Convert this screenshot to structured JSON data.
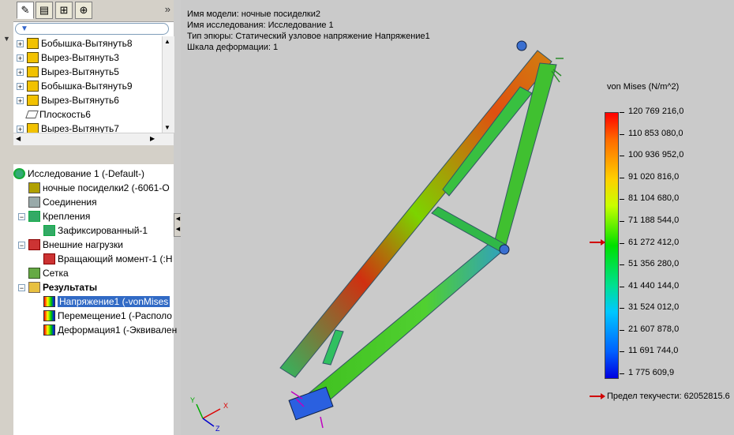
{
  "toolbar": {
    "more_label": "»"
  },
  "filter": {
    "value": "",
    "icon": "filter-icon"
  },
  "feature_tree": [
    {
      "label": "Бобышка-Вытянуть8",
      "icon": "boss-extrude-icon"
    },
    {
      "label": "Вырез-Вытянуть3",
      "icon": "cut-extrude-icon"
    },
    {
      "label": "Вырез-Вытянуть5",
      "icon": "cut-extrude-icon"
    },
    {
      "label": "Бобышка-Вытянуть9",
      "icon": "boss-extrude-icon"
    },
    {
      "label": "Вырез-Вытянуть6",
      "icon": "cut-extrude-icon"
    },
    {
      "label": "Плоскость6",
      "icon": "plane-icon"
    },
    {
      "label": "Вырез-Вытянуть7",
      "icon": "cut-extrude-icon"
    }
  ],
  "sim_tree": {
    "study": "Исследование 1 (-Default-)",
    "part": "ночные посиделки2 (-6061-O",
    "connections": "Соединения",
    "fixtures": "Крепления",
    "fixed": "Зафиксированный-1",
    "external_loads": "Внешние нагрузки",
    "torque": "Вращающий момент-1 (:Н",
    "mesh": "Сетка",
    "results": "Результаты",
    "stress": "Напряжение1 (-vonMises",
    "displacement": "Перемещение1 (-Располо",
    "strain": "Деформация1 (-Эквивален"
  },
  "viewport": {
    "model_name": "Имя модели: ночные посиделки2",
    "study_name": "Имя  исследования: Исследование 1",
    "plot_type": "Тип эпюры: Статический узловое напряжение Напряжение1",
    "deform_scale": "Шкала деформации: 1"
  },
  "legend": {
    "title": "von Mises (N/m^2)",
    "ticks": [
      "120 769 216,0",
      "110 853 080,0",
      "100 936 952,0",
      "91 020 816,0",
      "81 104 680,0",
      "71 188 544,0",
      "61 272 412,0",
      "51 356 280,0",
      "41 440 144,0",
      "31 524 012,0",
      "21 607 878,0",
      "11 691 744,0",
      "1 775 609,9"
    ],
    "yield_label": "Предел текучести: 62052815.6",
    "marker_color": "#d00000"
  },
  "triad": {
    "x": "X",
    "y": "Y",
    "z": "Z"
  }
}
